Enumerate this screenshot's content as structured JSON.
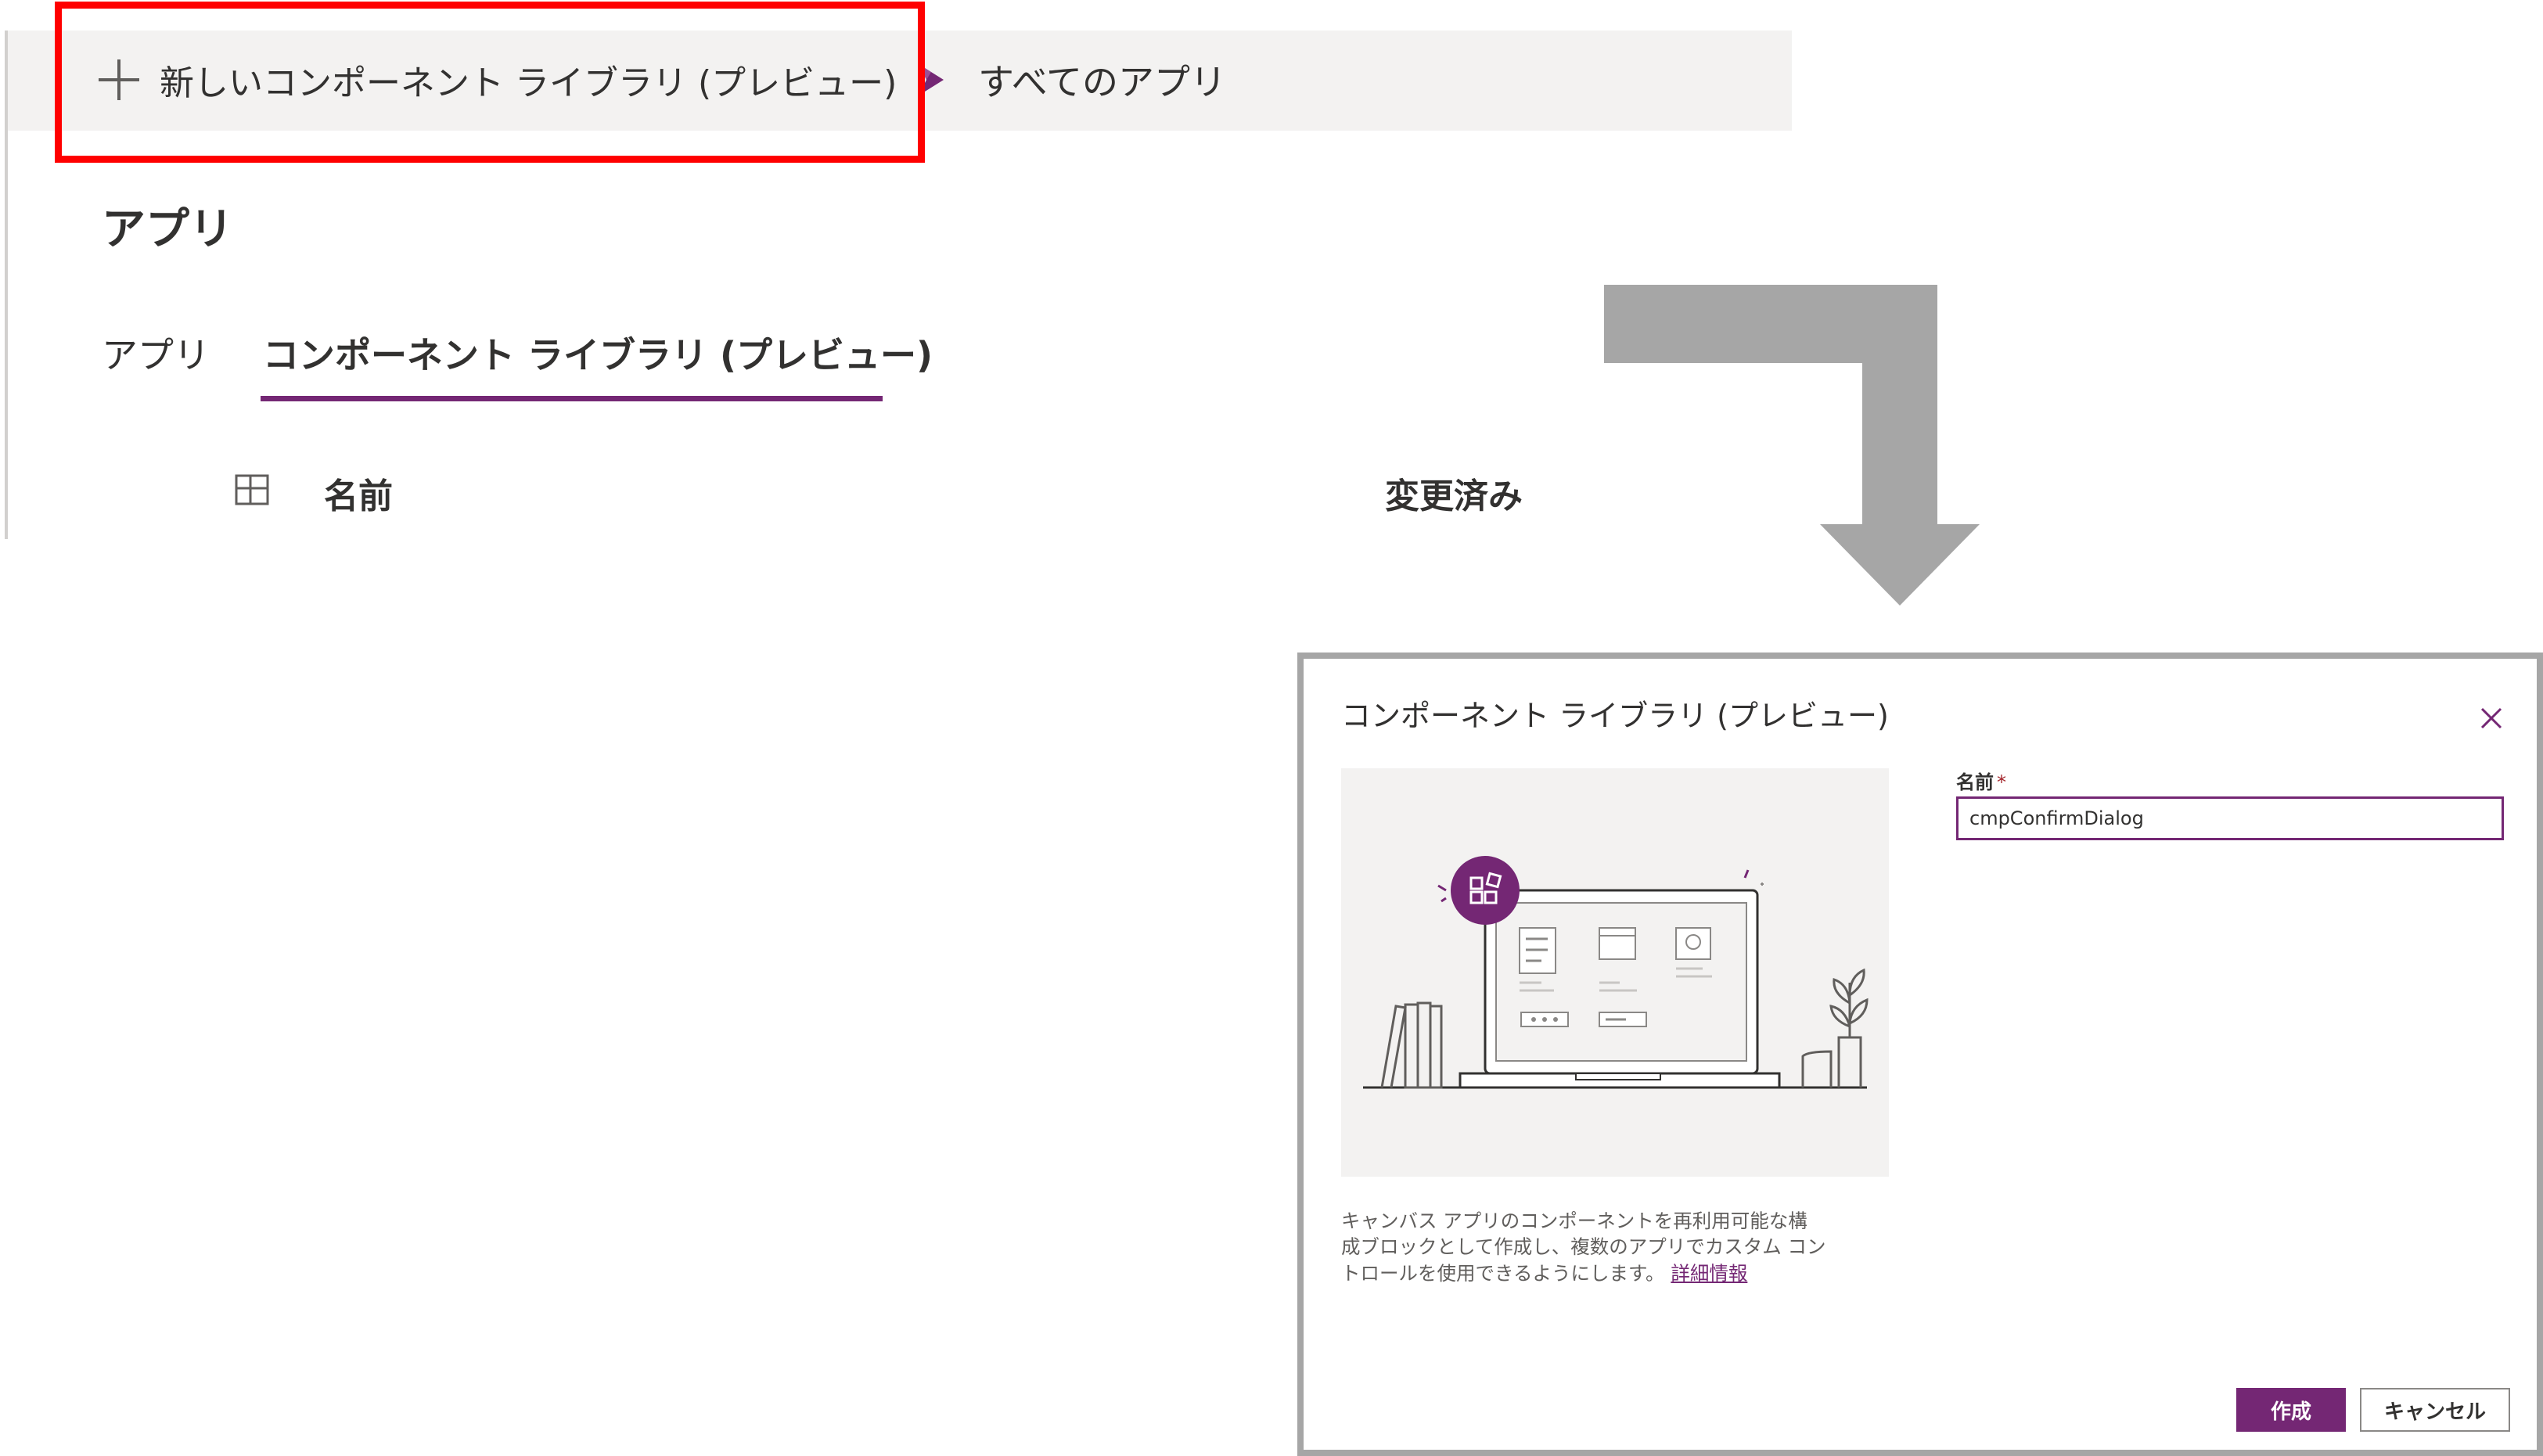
{
  "command_bar": {
    "new_library_label": "新しいコンポーネント ライブラリ (プレビュー)",
    "all_apps_label": "すべてのアプリ",
    "plus_icon": "plus-icon",
    "power_apps_icon": "power-apps-icon"
  },
  "page": {
    "title": "アプリ",
    "tabs": [
      {
        "label": "アプリ",
        "selected": false
      },
      {
        "label": "コンポーネント ライブラリ (プレビュー)",
        "selected": true
      }
    ],
    "columns": {
      "name": "名前",
      "modified": "変更済み"
    }
  },
  "dialog": {
    "title": "コンポーネント ライブラリ (プレビュー)",
    "name_label": "名前",
    "required_mark": "*",
    "name_value": "cmpConfirmDialog",
    "description": "キャンバス アプリのコンポーネントを再利用可能な構成ブロックとして作成し、複数のアプリでカスタム コントロールを使用できるようにします。",
    "learn_more": "詳細情報",
    "create_label": "作成",
    "cancel_label": "キャンセル"
  },
  "colors": {
    "accent": "#742774",
    "highlight": "#ff0000",
    "command_bar_bg": "#f3f2f1",
    "arrow": "#a6a6a6"
  }
}
